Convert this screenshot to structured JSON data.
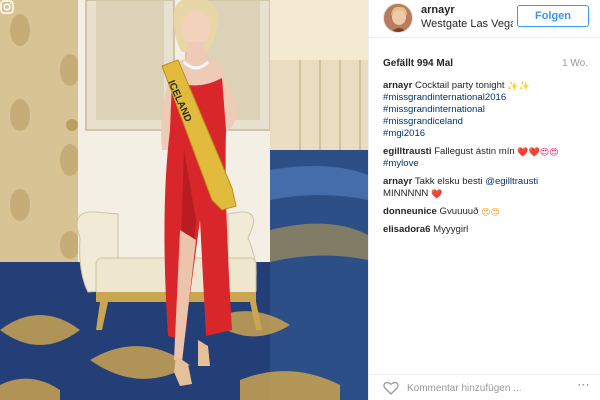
{
  "post": {
    "photo_icon": "instagram-glyph-icon",
    "sash_text": "ICELAND"
  },
  "header": {
    "username": "arnayr",
    "location": "Westgate Las Vegas Resort & Casino",
    "follow_label": "Folgen"
  },
  "stats": {
    "likes_label": "Gefällt 994 Mal",
    "age_label": "1 Wo."
  },
  "comments": [
    {
      "user": "arnayr",
      "text": "Cocktail party tonight",
      "emoji": "✨✨",
      "tags": [
        "#missgrandinternational2016",
        "#missgrandinternational",
        "#missgrandiceland",
        "#mgi2016"
      ]
    },
    {
      "user": "egilltrausti",
      "text": "Fallegust ástin mín",
      "emoji": "❤️❤️😍😍",
      "tag": "#mylove"
    },
    {
      "user": "arnayr",
      "text": "Takk elsku besti",
      "mention": "@egilltrausti",
      "line2": "MINNNNN",
      "emoji": "❤️"
    },
    {
      "user": "donneunice",
      "text": "Gvuuuuð",
      "emoji": "😍😍"
    },
    {
      "user": "elisadora6",
      "text": "Myyygirl"
    }
  ],
  "footer": {
    "like_icon": "heart-outline-icon",
    "comment_placeholder": "Kommentar hinzufügen ...",
    "more_label": "⋯",
    "more_icon": "more-options-icon"
  },
  "colors": {
    "accent": "#3897f0",
    "hashtag": "#003569",
    "heart": "#e0245e",
    "dress": "#d8262b"
  }
}
